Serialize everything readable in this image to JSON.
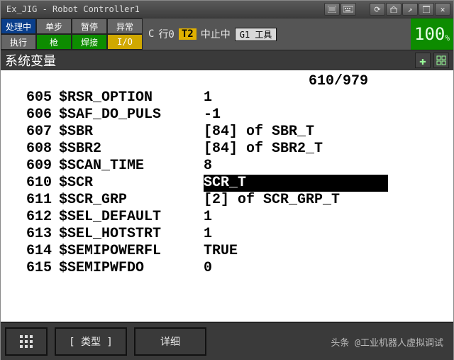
{
  "window": {
    "title": "Ex_JIG - Robot Controller1"
  },
  "titlebar_icons": [
    "list-icon",
    "keyboard-icon",
    "refresh-icon",
    "home-icon",
    "expand-icon",
    "fullscreen-icon",
    "close-icon"
  ],
  "top": {
    "row1": [
      "处理中",
      "单步",
      "暂停",
      "异常"
    ],
    "row2": [
      "执行",
      "枪",
      "焊接",
      "I/O"
    ],
    "status_c": "C",
    "status_line": "行0",
    "status_t2": "T2",
    "status_abort": "中止中",
    "tool": "G1 工具",
    "percent": "100"
  },
  "header": {
    "title": "系统变量"
  },
  "page": {
    "current": "610",
    "total": "979"
  },
  "vars": [
    {
      "line": "605",
      "name": "$RSR_OPTION",
      "value": "1"
    },
    {
      "line": "606",
      "name": "$SAF_DO_PULS",
      "value": "-1"
    },
    {
      "line": "607",
      "name": "$SBR",
      "value": "[84] of SBR_T"
    },
    {
      "line": "608",
      "name": "$SBR2",
      "value": "[84] of SBR2_T"
    },
    {
      "line": "609",
      "name": "$SCAN_TIME",
      "value": "8"
    },
    {
      "line": "610",
      "name": "$SCR",
      "value": "SCR_T",
      "selected": true
    },
    {
      "line": "611",
      "name": "$SCR_GRP",
      "value": "[2] of SCR_GRP_T"
    },
    {
      "line": "612",
      "name": "$SEL_DEFAULT",
      "value": "1"
    },
    {
      "line": "613",
      "name": "$SEL_HOTSTRT",
      "value": "1"
    },
    {
      "line": "614",
      "name": "$SEMIPOWERFL",
      "value": "TRUE"
    },
    {
      "line": "615",
      "name": "$SEMIPWFDO",
      "value": "0"
    }
  ],
  "footer": {
    "type": "[ 类型 ]",
    "detail": "详细"
  },
  "credit": "头条 @工业机器人虚拟调试"
}
